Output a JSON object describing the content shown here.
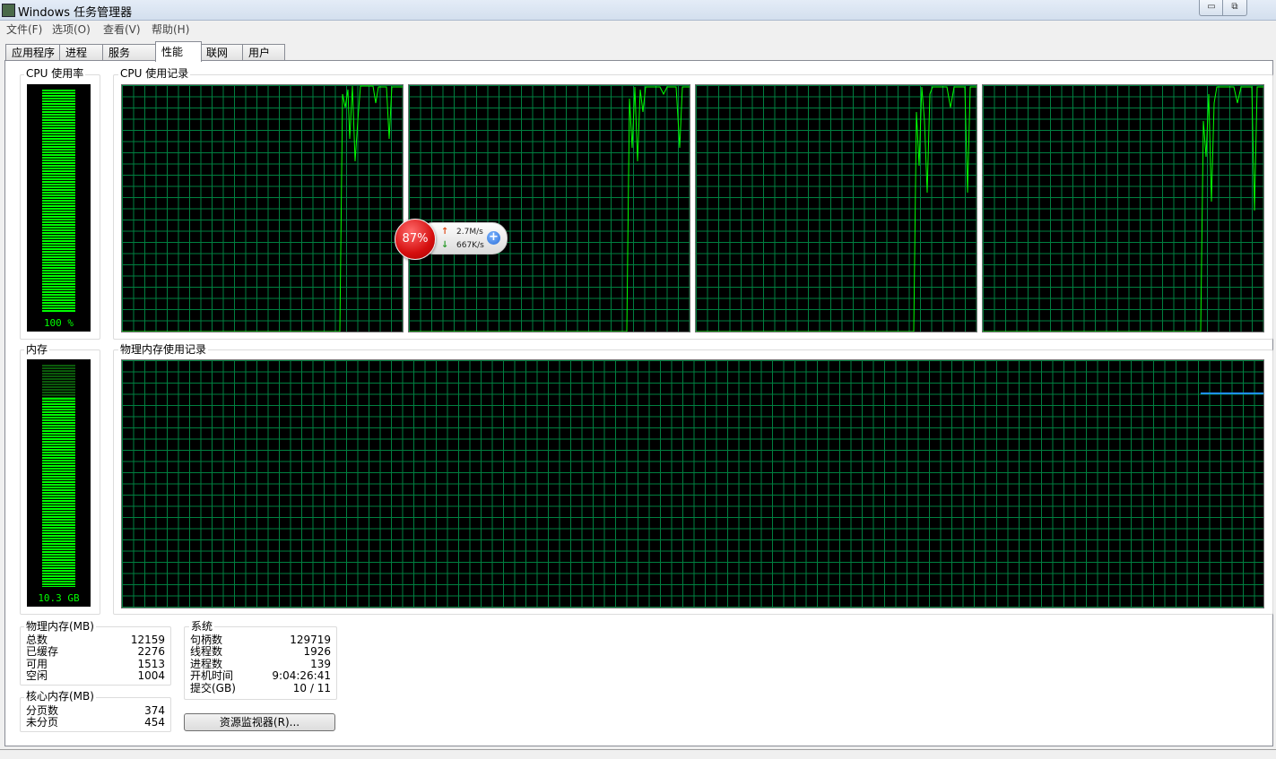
{
  "window": {
    "title": "Windows 任务管理器",
    "minimize_icon": "minimize-icon",
    "maximize_icon": "restore-icon"
  },
  "menu": [
    "文件(F)",
    "选项(O)",
    "查看(V)",
    "帮助(H)"
  ],
  "tabs": [
    "应用程序",
    "进程",
    "服务",
    "性能",
    "联网",
    "用户"
  ],
  "active_tab": "性能",
  "cpu": {
    "usage_label": "CPU 使用率",
    "usage_value": "100 %",
    "history_label": "CPU 使用记录",
    "usage_percent": 100,
    "core_count": 4
  },
  "memory": {
    "label": "内存",
    "value": "10.3 GB",
    "history_label": "物理内存使用记录",
    "used_fraction": 0.85
  },
  "physical_memory": {
    "title": "物理内存(MB)",
    "rows": [
      {
        "label": "总数",
        "value": "12159"
      },
      {
        "label": "已缓存",
        "value": "2276"
      },
      {
        "label": "可用",
        "value": "1513"
      },
      {
        "label": "空闲",
        "value": "1004"
      }
    ]
  },
  "kernel_memory": {
    "title": "核心内存(MB)",
    "rows": [
      {
        "label": "分页数",
        "value": "374"
      },
      {
        "label": "未分页",
        "value": "454"
      }
    ]
  },
  "system": {
    "title": "系统",
    "rows": [
      {
        "label": "句柄数",
        "value": "129719"
      },
      {
        "label": "线程数",
        "value": "1926"
      },
      {
        "label": "进程数",
        "value": "139"
      },
      {
        "label": "开机时间",
        "value": "9:04:26:41"
      },
      {
        "label": "提交(GB)",
        "value": "10 / 11"
      }
    ]
  },
  "resource_monitor_button": "资源监视器(R)...",
  "net_widget": {
    "percent": "87%",
    "upload": "2.7M/s",
    "download": "667K/s",
    "up_arrow": "↑",
    "down_arrow": "↓",
    "plus": "+"
  },
  "colors": {
    "graph_line": "#00ff00",
    "grid": "#008040",
    "memory_line": "#1e90ff"
  }
}
